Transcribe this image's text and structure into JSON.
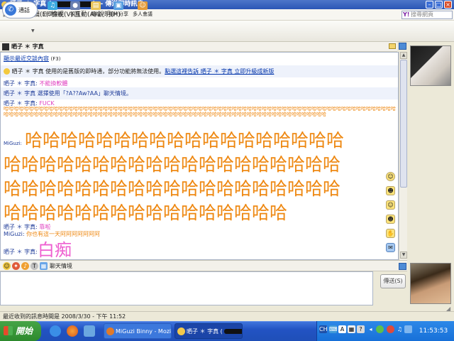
{
  "window": {
    "title_prefix": "晒子 ＊ 字真 (",
    "title_suffix": ") -- 傳送即時訊息"
  },
  "menu": {
    "items": [
      "訊息(M)",
      "編輯(E)",
      "檢視(V)",
      "互動(A)",
      "說明(H)"
    ],
    "search_placeholder": "搜尋網頁"
  },
  "toolbar": {
    "call_label": "通話",
    "tools": [
      "分享頻道",
      "視訊",
      "傳檔",
      "相片分享",
      "多人會議"
    ]
  },
  "contact": {
    "name": "晒子 ＊ 字真"
  },
  "chat": {
    "history_link": "顯示最近交談內容",
    "history_hotkey": "(F3)",
    "notice_text": "晒子 ＊ 字真 使用的是舊版的即時通，部分功能將無法使用。",
    "notice_link": "點選這裡告訴 晒子 ＊ 字真 立即升級成新版",
    "theme_msg": "晒子 ＊ 字真 選擇使用「?A??Aw?AA」聊天情境。",
    "msg1_sender": "晒子 ＊ 字真:",
    "msg1_text": "不能換軟體",
    "msg2_sender": "晒子 ＊ 字真:",
    "msg2_text": "FUCK",
    "repeat_text": "哈哈哈哈哈哈哈哈哈哈哈哈哈哈哈哈哈哈哈哈哈哈哈哈哈哈哈哈哈哈哈哈哈哈哈哈哈哈哈哈哈哈哈哈哈哈哈哈哈哈哈哈哈哈哈哈哈哈哈哈哈哈哈哈哈哈哈哈哈哈哈哈哈哈哈哈哈哈哈哈哈哈哈哈哈哈哈哈哈哈哈哈哈哈哈哈哈哈哈哈哈哈哈哈哈哈哈哈哈哈哈哈哈哈哈哈哈哈哈哈哈哈哈哈哈哈哈哈哈哈哈哈哈哈哈哈哈哈哈哈哈哈哈哈",
    "msg3_sender": "MiGuzi:",
    "big_line1": "哈哈哈哈哈哈哈哈哈哈哈哈哈哈哈哈哈哈",
    "big_line2": "哈哈哈哈哈哈哈哈哈哈哈哈哈哈哈哈哈哈哈",
    "big_line3": "哈哈哈哈哈哈哈哈哈哈哈哈哈哈哈哈哈哈哈",
    "big_line4": "哈哈哈哈哈哈哈哈哈哈哈哈哈哈哈哈",
    "msg4_sender": "晒子 ＊ 字真:",
    "msg4_text": "靠啦",
    "msg5_sender": "MiGuzi:",
    "msg5_text": "你也有這一天阿阿阿阿阿阿阿",
    "msg6_sender": "晒子 ＊ 字真:",
    "msg6_text": "白痴"
  },
  "format_bar": {
    "label": "聊天情境"
  },
  "send_button": "傳送(S)",
  "status": {
    "text": "最近收到的訊息時間是 2008/3/30 - 下午 11:52"
  },
  "taskbar": {
    "start_label": "開始",
    "task1": "MiGuzi Binny - Mozilla ...",
    "task2": "晒子 ＊ 字真 (",
    "tray_lang": "CH",
    "clock": "11:53:53"
  },
  "colors": {
    "accent": "#2a56b6",
    "chat_orange": "#ee8812",
    "chat_pink": "#e040c0",
    "link_blue": "#0033aa"
  }
}
